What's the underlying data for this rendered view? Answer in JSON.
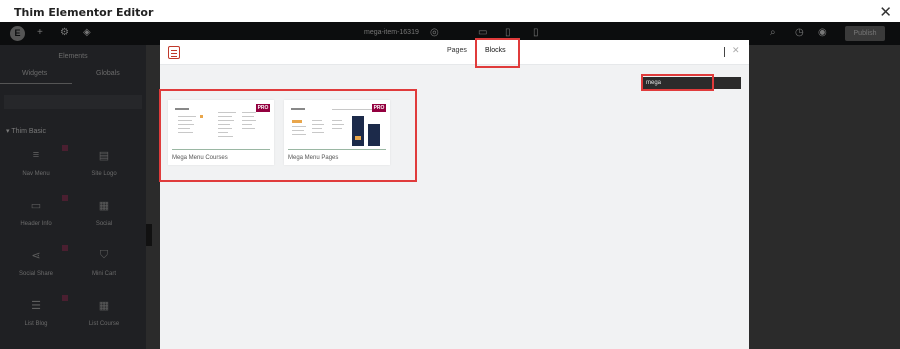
{
  "window": {
    "title": "Thim Elementor Editor",
    "close_symbol": "✕"
  },
  "topbar": {
    "page_name": "mega-item-16319",
    "publish_label": "Publish",
    "logo_letter": "E"
  },
  "sidebar": {
    "title": "Elements",
    "tabs": [
      "Widgets",
      "Globals"
    ],
    "section_title": "Thim Basic",
    "widgets": [
      {
        "label": "Nav Menu",
        "icon": "nav-menu-icon",
        "glyph": "≡"
      },
      {
        "label": "Site Logo",
        "icon": "site-logo-icon",
        "glyph": "▤"
      },
      {
        "label": "Header Info",
        "icon": "header-info-icon",
        "glyph": "▭"
      },
      {
        "label": "Social",
        "icon": "social-icon",
        "glyph": "▦"
      },
      {
        "label": "Social Share",
        "icon": "share-icon",
        "glyph": "⋖"
      },
      {
        "label": "Mini Cart",
        "icon": "cart-icon",
        "glyph": "⛉"
      },
      {
        "label": "List Blog",
        "icon": "list-blog-icon",
        "glyph": "☰"
      },
      {
        "label": "List Course",
        "icon": "list-course-icon",
        "glyph": "▦"
      }
    ]
  },
  "modal": {
    "tabs": {
      "pages": "Pages",
      "blocks": "Blocks"
    },
    "active_tab": "Blocks",
    "close_symbol": "✕",
    "search": {
      "value": "mega"
    },
    "cards": [
      {
        "name": "Mega Menu Courses",
        "badge": "PRO"
      },
      {
        "name": "Mega Menu Pages",
        "badge": "PRO"
      }
    ]
  }
}
